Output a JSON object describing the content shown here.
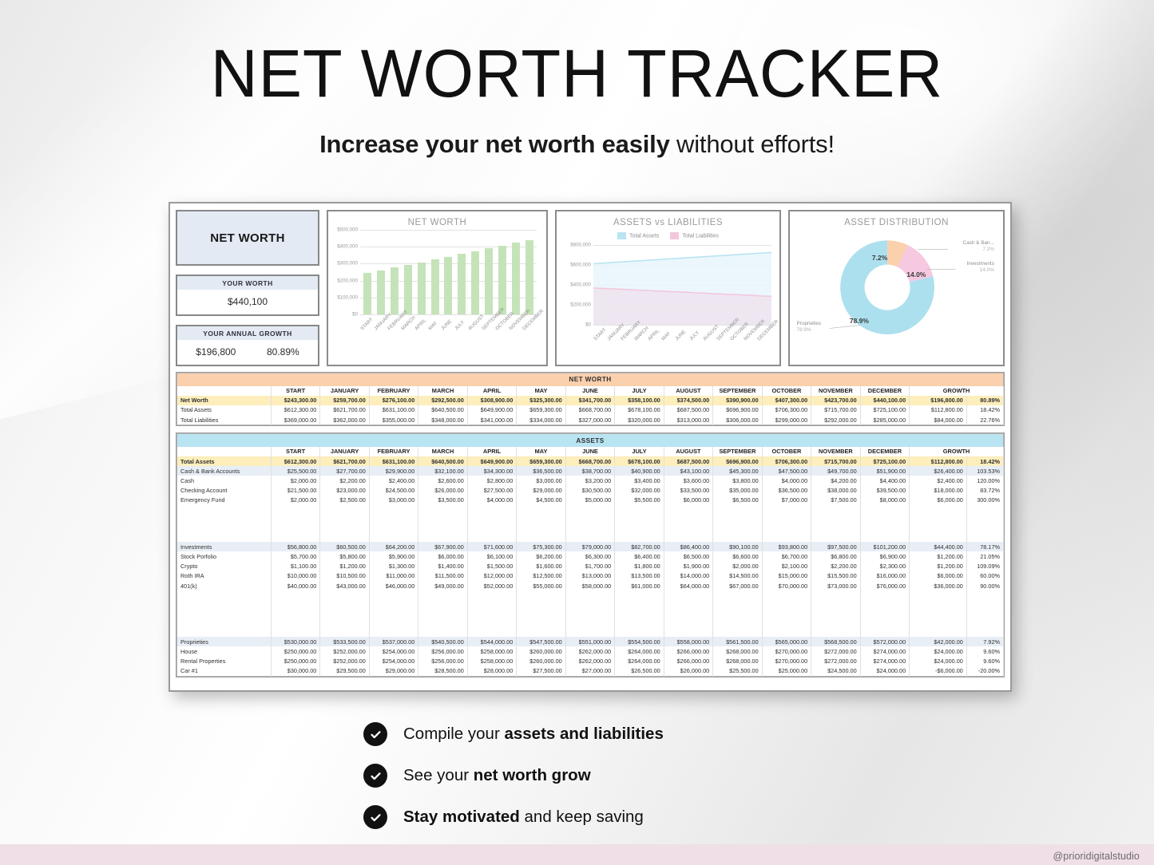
{
  "header": {
    "title": "NET WORTH TRACKER",
    "subtitle_bold": "Increase your net worth easily",
    "subtitle_rest": " without efforts!"
  },
  "watermark": "@prioridigitalstudio",
  "kpi": {
    "main_label": "NET WORTH",
    "worth_label": "YOUR WORTH",
    "worth_value": "$440,100",
    "growth_label": "YOUR ANNUAL GROWTH",
    "growth_value": "$196,800",
    "growth_percent": "80.89%"
  },
  "colors": {
    "bar_green": "#c5e3b8",
    "assets_blue": "#b9e4f2",
    "liabilities_pink": "#f4c6dd",
    "banner_orange": "#fbd0ad",
    "banner_blue": "#b9e4f2",
    "total_row_yellow": "#fdeebc",
    "group_row": "#e8eef5",
    "donut_cash": "#fbd0ad",
    "donut_investments": "#f7c9e0",
    "donut_properties": "#ade0ee"
  },
  "chart_data": [
    {
      "type": "bar",
      "title": "NET WORTH",
      "categories": [
        "START",
        "JANUARY",
        "FEBRUARY",
        "MARCH",
        "APRIL",
        "MAY",
        "JUNE",
        "JULY",
        "AUGUST",
        "SEPTEMBER",
        "OCTOBER",
        "NOVEMBER",
        "DECEMBER"
      ],
      "values": [
        243300,
        259700,
        276100,
        292500,
        308900,
        325300,
        341700,
        358100,
        374500,
        390900,
        407300,
        423700,
        440100
      ],
      "ylim": [
        0,
        500000
      ],
      "yticks": [
        "$0",
        "$100,000",
        "$200,000",
        "$300,000",
        "$400,000",
        "$500,000"
      ],
      "xlabel": "",
      "ylabel": "",
      "grid": true
    },
    {
      "type": "area",
      "title": "ASSETS vs LIABILITIES",
      "categories": [
        "START",
        "JANUARY",
        "FEBRUARY",
        "MARCH",
        "APRIL",
        "MAY",
        "JUNE",
        "JULY",
        "AUGUST",
        "SEPTEMBER",
        "OCTOBER",
        "NOVEMBER",
        "DECEMBER"
      ],
      "series": [
        {
          "name": "Total Assets",
          "values": [
            612300,
            621700,
            631100,
            640500,
            649900,
            659300,
            668700,
            678100,
            687500,
            696900,
            706300,
            715700,
            725100
          ]
        },
        {
          "name": "Total Liabilities",
          "values": [
            369000,
            362000,
            355000,
            348000,
            341000,
            334000,
            327000,
            320000,
            313000,
            306000,
            299000,
            292000,
            285000
          ]
        }
      ],
      "ylim": [
        0,
        800000
      ],
      "yticks": [
        "$0",
        "$200,000",
        "$400,000",
        "$600,000",
        "$800,000"
      ],
      "legend": [
        "Total Assets",
        "Total Liabilities"
      ],
      "legend_position": "top",
      "grid": true
    },
    {
      "type": "pie",
      "title": "ASSET DISTRIBUTION",
      "labels": [
        "Cash & Ban...",
        "Investments",
        "Proprieties"
      ],
      "values": [
        7.2,
        14.0,
        78.9
      ],
      "value_labels": [
        "7.2%",
        "14.0%",
        "78.9%"
      ],
      "callout_labels": [
        {
          "name": "Cash & Ban...",
          "pct": "7.2%"
        },
        {
          "name": "Investments",
          "pct": "14.0%"
        },
        {
          "name": "Proprieties",
          "pct": "78.9%"
        }
      ]
    }
  ],
  "net_worth_table": {
    "banner": "NET WORTH",
    "columns": [
      "",
      "START",
      "JANUARY",
      "FEBRUARY",
      "MARCH",
      "APRIL",
      "MAY",
      "JUNE",
      "JULY",
      "AUGUST",
      "SEPTEMBER",
      "OCTOBER",
      "NOVEMBER",
      "DECEMBER",
      "GROWTH",
      ""
    ],
    "rows": [
      {
        "label": "Net Worth",
        "style": "total",
        "values": [
          "$243,300.00",
          "$259,700.00",
          "$276,100.00",
          "$292,500.00",
          "$308,900.00",
          "$325,300.00",
          "$341,700.00",
          "$358,100.00",
          "$374,500.00",
          "$390,900.00",
          "$407,300.00",
          "$423,700.00",
          "$440,100.00"
        ],
        "growth": "$196,800.00",
        "growth_pct": "80.89%"
      },
      {
        "label": "Total Assets",
        "style": "sub",
        "values": [
          "$612,300.00",
          "$621,700.00",
          "$631,100.00",
          "$640,500.00",
          "$649,900.00",
          "$659,300.00",
          "$668,700.00",
          "$678,100.00",
          "$687,500.00",
          "$696,900.00",
          "$706,300.00",
          "$715,700.00",
          "$725,100.00"
        ],
        "growth": "$112,800.00",
        "growth_pct": "18.42%"
      },
      {
        "label": "Total Liabilities",
        "style": "sub",
        "values": [
          "$369,000.00",
          "$362,000.00",
          "$355,000.00",
          "$348,000.00",
          "$341,000.00",
          "$334,000.00",
          "$327,000.00",
          "$320,000.00",
          "$313,000.00",
          "$306,000.00",
          "$299,000.00",
          "$292,000.00",
          "$285,000.00"
        ],
        "growth": "$84,000.00",
        "growth_pct": "22.76%"
      }
    ]
  },
  "assets_table": {
    "banner": "ASSETS",
    "columns": [
      "",
      "START",
      "JANUARY",
      "FEBRUARY",
      "MARCH",
      "APRIL",
      "MAY",
      "JUNE",
      "JULY",
      "AUGUST",
      "SEPTEMBER",
      "OCTOBER",
      "NOVEMBER",
      "DECEMBER",
      "GROWTH",
      ""
    ],
    "rows": [
      {
        "label": "Total Assets",
        "style": "total",
        "values": [
          "$612,300.00",
          "$621,700.00",
          "$631,100.00",
          "$640,500.00",
          "$649,900.00",
          "$659,300.00",
          "$668,700.00",
          "$678,100.00",
          "$687,500.00",
          "$696,900.00",
          "$706,300.00",
          "$715,700.00",
          "$725,100.00"
        ],
        "growth": "$112,800.00",
        "growth_pct": "18.42%"
      },
      {
        "label": "Cash & Bank Accounts",
        "style": "group",
        "values": [
          "$25,500.00",
          "$27,700.00",
          "$29,900.00",
          "$32,100.00",
          "$34,300.00",
          "$36,500.00",
          "$38,700.00",
          "$40,900.00",
          "$43,100.00",
          "$45,300.00",
          "$47,500.00",
          "$49,700.00",
          "$51,900.00"
        ],
        "growth": "$26,400.00",
        "growth_pct": "103.53%"
      },
      {
        "label": "Cash",
        "style": "sub",
        "values": [
          "$2,000.00",
          "$2,200.00",
          "$2,400.00",
          "$2,600.00",
          "$2,800.00",
          "$3,000.00",
          "$3,200.00",
          "$3,400.00",
          "$3,600.00",
          "$3,800.00",
          "$4,000.00",
          "$4,200.00",
          "$4,400.00"
        ],
        "growth": "$2,400.00",
        "growth_pct": "120.00%"
      },
      {
        "label": "Checking Account",
        "style": "sub",
        "values": [
          "$21,500.00",
          "$23,000.00",
          "$24,500.00",
          "$26,000.00",
          "$27,500.00",
          "$29,000.00",
          "$30,500.00",
          "$32,000.00",
          "$33,500.00",
          "$35,000.00",
          "$36,500.00",
          "$38,000.00",
          "$39,500.00"
        ],
        "growth": "$18,000.00",
        "growth_pct": "83.72%"
      },
      {
        "label": "Emergency Fund",
        "style": "sub",
        "values": [
          "$2,000.00",
          "$2,500.00",
          "$3,000.00",
          "$3,500.00",
          "$4,000.00",
          "$4,500.00",
          "$5,000.00",
          "$5,500.00",
          "$6,000.00",
          "$6,500.00",
          "$7,000.00",
          "$7,500.00",
          "$8,000.00"
        ],
        "growth": "$6,000.00",
        "growth_pct": "300.00%"
      },
      {
        "label": "",
        "style": "blank",
        "values": [
          "",
          "",
          "",
          "",
          "",
          "",
          "",
          "",
          "",
          "",
          "",
          "",
          ""
        ],
        "growth": "",
        "growth_pct": ""
      },
      {
        "label": "",
        "style": "blank",
        "values": [
          "",
          "",
          "",
          "",
          "",
          "",
          "",
          "",
          "",
          "",
          "",
          "",
          ""
        ],
        "growth": "",
        "growth_pct": ""
      },
      {
        "label": "",
        "style": "blank",
        "values": [
          "",
          "",
          "",
          "",
          "",
          "",
          "",
          "",
          "",
          "",
          "",
          "",
          ""
        ],
        "growth": "",
        "growth_pct": ""
      },
      {
        "label": "",
        "style": "blank",
        "values": [
          "",
          "",
          "",
          "",
          "",
          "",
          "",
          "",
          "",
          "",
          "",
          "",
          ""
        ],
        "growth": "",
        "growth_pct": ""
      },
      {
        "label": "Investments",
        "style": "group",
        "values": [
          "$56,800.00",
          "$60,500.00",
          "$64,200.00",
          "$67,900.00",
          "$71,600.00",
          "$75,300.00",
          "$79,000.00",
          "$82,700.00",
          "$86,400.00",
          "$90,100.00",
          "$93,800.00",
          "$97,500.00",
          "$101,200.00"
        ],
        "growth": "$44,400.00",
        "growth_pct": "78.17%"
      },
      {
        "label": "Stock Porfolio",
        "style": "sub",
        "values": [
          "$5,700.00",
          "$5,800.00",
          "$5,900.00",
          "$6,000.00",
          "$6,100.00",
          "$6,200.00",
          "$6,300.00",
          "$6,400.00",
          "$6,500.00",
          "$6,600.00",
          "$6,700.00",
          "$6,800.00",
          "$6,900.00"
        ],
        "growth": "$1,200.00",
        "growth_pct": "21.05%"
      },
      {
        "label": "Crypto",
        "style": "sub",
        "values": [
          "$1,100.00",
          "$1,200.00",
          "$1,300.00",
          "$1,400.00",
          "$1,500.00",
          "$1,600.00",
          "$1,700.00",
          "$1,800.00",
          "$1,900.00",
          "$2,000.00",
          "$2,100.00",
          "$2,200.00",
          "$2,300.00"
        ],
        "growth": "$1,200.00",
        "growth_pct": "109.09%"
      },
      {
        "label": "Roth IRA",
        "style": "sub",
        "values": [
          "$10,000.00",
          "$10,500.00",
          "$11,000.00",
          "$11,500.00",
          "$12,000.00",
          "$12,500.00",
          "$13,000.00",
          "$13,500.00",
          "$14,000.00",
          "$14,500.00",
          "$15,000.00",
          "$15,500.00",
          "$16,000.00"
        ],
        "growth": "$6,000.00",
        "growth_pct": "60.00%"
      },
      {
        "label": "401(k)",
        "style": "sub",
        "values": [
          "$40,000.00",
          "$43,000.00",
          "$46,000.00",
          "$49,000.00",
          "$52,000.00",
          "$55,000.00",
          "$58,000.00",
          "$61,000.00",
          "$64,000.00",
          "$67,000.00",
          "$70,000.00",
          "$73,000.00",
          "$76,000.00"
        ],
        "growth": "$36,000.00",
        "growth_pct": "90.00%"
      },
      {
        "label": "",
        "style": "blank",
        "values": [
          "",
          "",
          "",
          "",
          "",
          "",
          "",
          "",
          "",
          "",
          "",
          "",
          ""
        ],
        "growth": "",
        "growth_pct": ""
      },
      {
        "label": "",
        "style": "blank",
        "values": [
          "",
          "",
          "",
          "",
          "",
          "",
          "",
          "",
          "",
          "",
          "",
          "",
          ""
        ],
        "growth": "",
        "growth_pct": ""
      },
      {
        "label": "",
        "style": "blank",
        "values": [
          "",
          "",
          "",
          "",
          "",
          "",
          "",
          "",
          "",
          "",
          "",
          "",
          ""
        ],
        "growth": "",
        "growth_pct": ""
      },
      {
        "label": "",
        "style": "blank",
        "values": [
          "",
          "",
          "",
          "",
          "",
          "",
          "",
          "",
          "",
          "",
          "",
          "",
          ""
        ],
        "growth": "",
        "growth_pct": ""
      },
      {
        "label": "",
        "style": "blank",
        "values": [
          "",
          "",
          "",
          "",
          "",
          "",
          "",
          "",
          "",
          "",
          "",
          "",
          ""
        ],
        "growth": "",
        "growth_pct": ""
      },
      {
        "label": "Proprieties",
        "style": "group",
        "values": [
          "$530,000.00",
          "$533,500.00",
          "$537,000.00",
          "$540,500.00",
          "$544,000.00",
          "$547,500.00",
          "$551,000.00",
          "$554,500.00",
          "$558,000.00",
          "$561,500.00",
          "$565,000.00",
          "$568,500.00",
          "$572,000.00"
        ],
        "growth": "$42,000.00",
        "growth_pct": "7.92%"
      },
      {
        "label": "House",
        "style": "sub",
        "values": [
          "$250,000.00",
          "$252,000.00",
          "$254,000.00",
          "$256,000.00",
          "$258,000.00",
          "$260,000.00",
          "$262,000.00",
          "$264,000.00",
          "$266,000.00",
          "$268,000.00",
          "$270,000.00",
          "$272,000.00",
          "$274,000.00"
        ],
        "growth": "$24,000.00",
        "growth_pct": "9.60%"
      },
      {
        "label": "Rental Properties",
        "style": "sub",
        "values": [
          "$250,000.00",
          "$252,000.00",
          "$254,000.00",
          "$256,000.00",
          "$258,000.00",
          "$260,000.00",
          "$262,000.00",
          "$264,000.00",
          "$266,000.00",
          "$268,000.00",
          "$270,000.00",
          "$272,000.00",
          "$274,000.00"
        ],
        "growth": "$24,000.00",
        "growth_pct": "9.60%"
      },
      {
        "label": "Car #1",
        "style": "sub",
        "values": [
          "$30,000.00",
          "$29,500.00",
          "$29,000.00",
          "$28,500.00",
          "$28,000.00",
          "$27,500.00",
          "$27,000.00",
          "$26,500.00",
          "$26,000.00",
          "$25,500.00",
          "$25,000.00",
          "$24,500.00",
          "$24,000.00"
        ],
        "growth": "-$6,000.00",
        "growth_pct": "-20.00%"
      }
    ]
  },
  "bullets": [
    {
      "plain_before": "Compile your ",
      "bold": "assets and liabilities",
      "plain_after": ""
    },
    {
      "plain_before": "See your ",
      "bold": "net worth grow",
      "plain_after": ""
    },
    {
      "plain_before": "",
      "bold": "Stay motivated",
      "plain_after": " and keep saving"
    }
  ]
}
